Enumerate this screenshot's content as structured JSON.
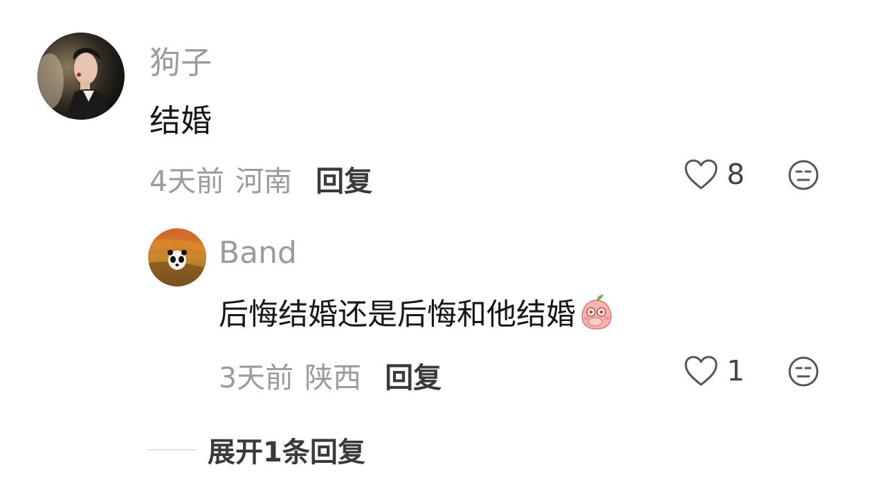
{
  "comments": [
    {
      "username": "狗子",
      "text": "结婚",
      "time": "4天前",
      "location": "河南",
      "reply_label": "回复",
      "likes": "8"
    }
  ],
  "replies": [
    {
      "username": "Band",
      "text": "后悔结婚还是后悔和他结婚",
      "emoji": "peach-blush-emoji",
      "time": "3天前",
      "location": "陕西",
      "reply_label": "回复",
      "likes": "1"
    }
  ],
  "expand_label": "展开1条回复",
  "icons": {
    "like": "heart-outline-icon",
    "dislike": "unamused-face-icon"
  },
  "colors": {
    "username": "#9b9b9b",
    "text": "#161616",
    "action": "#3a3a3a"
  }
}
